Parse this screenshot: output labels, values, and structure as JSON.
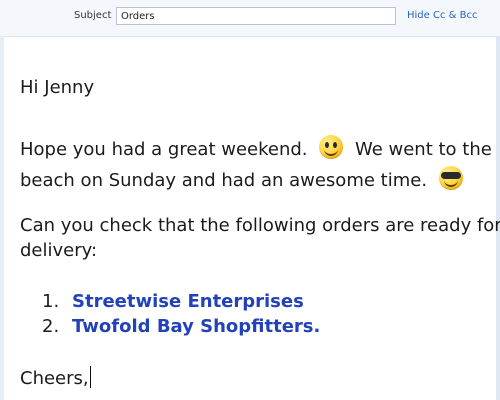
{
  "header": {
    "subject_label": "Subject",
    "subject_value": "Orders",
    "hide_cc_bcc": "Hide Cc & Bcc"
  },
  "body": {
    "greeting": "Hi Jenny",
    "p1_a": "Hope you had a great weekend.",
    "p1_b": "We went to the",
    "p1_c": "beach on Sunday and had an awesome time.",
    "p2_a": "Can you check that the following orders are ready for",
    "p2_b": "delivery:",
    "list": [
      {
        "num": "1.",
        "label": "Streetwise Enterprises"
      },
      {
        "num": "2.",
        "label": "Twofold Bay Shopfitters."
      }
    ],
    "signoff": "Cheers,"
  },
  "icons": {
    "emoji_1": "smiley-emoji-icon",
    "emoji_2": "sunglasses-emoji-icon"
  },
  "colors": {
    "link": "#2342b8",
    "hide_cc": "#2b63c6",
    "header_bg": "#f4f7fb"
  }
}
